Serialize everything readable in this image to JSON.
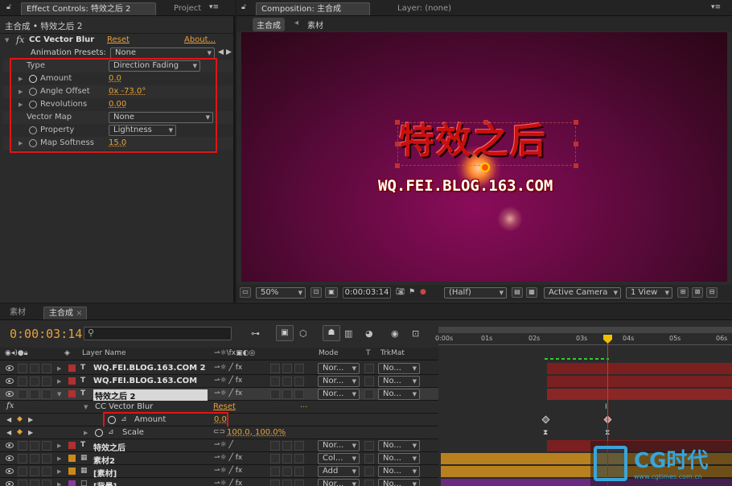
{
  "effect_panel": {
    "tab_label": "Effect Controls: 特效之后 2",
    "tab_project": "Project",
    "breadcrumb": "主合成 • 特效之后 2",
    "effect_name": "CC Vector Blur",
    "reset": "Reset",
    "about": "About...",
    "presets_label": "Animation Presets:",
    "presets_value": "None",
    "props": [
      {
        "label": "Type",
        "type": "dropdown",
        "value": "Direction Fading"
      },
      {
        "label": "Amount",
        "type": "value",
        "value": "0.0"
      },
      {
        "label": "Angle Offset",
        "type": "value",
        "value": "0x -73.0°"
      },
      {
        "label": "Revolutions",
        "type": "value",
        "value": "0.00"
      },
      {
        "label": "Vector Map",
        "type": "dropdown",
        "value": "None"
      },
      {
        "label": "Property",
        "type": "dropdown",
        "value": "Lightness"
      },
      {
        "label": "Map Softness",
        "type": "value",
        "value": "15.0"
      }
    ]
  },
  "comp_panel": {
    "tab_label": "Composition: 主合成",
    "layer_tab": "Layer: (none)",
    "crumb1": "主合成",
    "crumb2": "素材",
    "title_text": "特效之后",
    "url_text": "WQ.FEI.BLOG.163.COM",
    "zoom": "50%",
    "timecode": "0:00:03:14",
    "resolution": "(Half)",
    "camera": "Active Camera",
    "view": "1 View"
  },
  "timeline": {
    "tab1": "素材",
    "tab2": "主合成",
    "timecode": "0:00:03:14",
    "col_layer": "Layer Name",
    "col_mode": "Mode",
    "col_t": "T",
    "col_trkmat": "TrkMat",
    "ruler": [
      "0:00s",
      "01s",
      "02s",
      "03s",
      "04s",
      "05s",
      "06s"
    ],
    "layers": [
      {
        "name": "WQ.FEI.BLOG.163.COM 2",
        "color": "#b03030",
        "type": "T",
        "mode": "Nor...",
        "trk": "No...",
        "bar": "#7a2020"
      },
      {
        "name": "WQ.FEI.BLOG.163.COM",
        "color": "#b03030",
        "type": "T",
        "mode": "Nor...",
        "trk": "No...",
        "bar": "#7a2020"
      },
      {
        "name": "特效之后 2",
        "color": "#b03030",
        "type": "T",
        "mode": "Nor...",
        "trk": "No...",
        "bar": "#8a2626"
      },
      {
        "name": "特效之后",
        "color": "#b03030",
        "type": "T",
        "mode": "Nor...",
        "trk": "No...",
        "bar": "#7a2020"
      },
      {
        "name": "素材2",
        "color": "#c98a1a",
        "type": "clip",
        "mode": "Col...",
        "trk": "No...",
        "bar": "#b8801e"
      },
      {
        "name": "[素材]",
        "color": "#c98a1a",
        "type": "clip",
        "mode": "Add",
        "trk": "No...",
        "bar": "#b8801e"
      },
      {
        "name": "[背景]",
        "color": "#8a3aa0",
        "type": "solid",
        "mode": "Nor...",
        "trk": "No...",
        "bar": "#6a2a80"
      }
    ],
    "sub_effect": "CC Vector Blur",
    "sub_reset": "Reset",
    "sub_dots": "...",
    "fx_label": "fx",
    "amount_label": "Amount",
    "amount_value": "0.0",
    "scale_label": "Scale",
    "scale_value": "100.0, 100.0%"
  },
  "watermark": {
    "brand": "CG时代",
    "url": "www.cgtimes.com.cn"
  }
}
